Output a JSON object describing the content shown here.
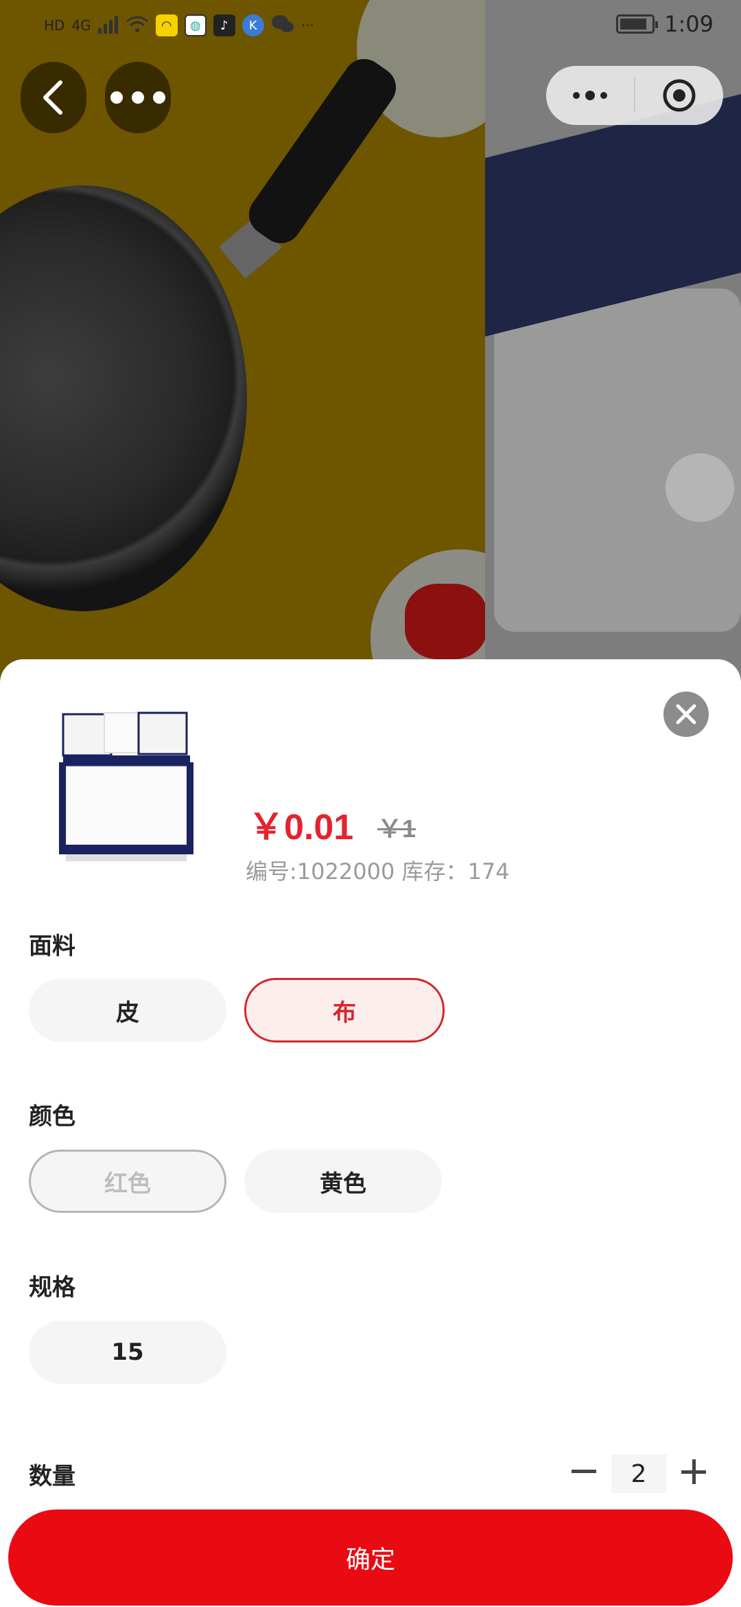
{
  "status_bar": {
    "left_indicators": [
      "HD",
      "4G"
    ],
    "more": "···",
    "time": "1:09"
  },
  "product": {
    "price": "￥0.01",
    "original_price": "￥1",
    "meta": "编号:1022000 库存：174"
  },
  "sections": {
    "material": {
      "label": "面料",
      "options": [
        "皮",
        "布"
      ],
      "selected": "布"
    },
    "color": {
      "label": "颜色",
      "options": [
        "红色",
        "黄色"
      ],
      "disabled": "红色"
    },
    "spec": {
      "label": "规格",
      "options": [
        "15"
      ]
    },
    "quantity": {
      "label": "数量",
      "value": "2"
    }
  },
  "confirm_label": "确定",
  "colors": {
    "accent": "#ea0a12",
    "price": "#e4232f"
  }
}
